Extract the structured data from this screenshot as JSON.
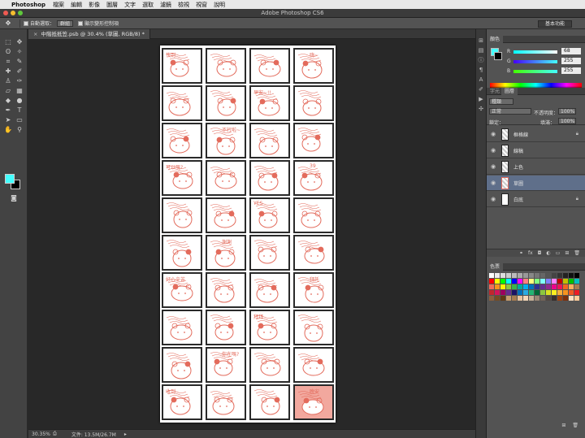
{
  "menubar": {
    "app_name": "Photoshop",
    "items": [
      "檔案",
      "編輯",
      "影像",
      "圖層",
      "文字",
      "選取",
      "濾鏡",
      "檢視",
      "視窗",
      "說明"
    ]
  },
  "window": {
    "title": "Adobe Photoshop CS6"
  },
  "options_bar": {
    "auto_select_label": "自動選取：",
    "auto_select_value": "群組",
    "show_transform_label": "顯示變形控制項",
    "workspace": "基本功能"
  },
  "document_tab": {
    "label": "中階抵抵笠.psb @ 30.4% (草圖, RGB/8) *"
  },
  "status_bar": {
    "zoom": "30.35%",
    "doc_size": "文件: 13.5M/26.7M"
  },
  "color_panel": {
    "tabs": [
      "顏色"
    ],
    "r_label": "R",
    "g_label": "G",
    "b_label": "B",
    "r_value": "68",
    "g_value": "255",
    "b_value": "255",
    "foreground": "#44ffff",
    "background": "#000000"
  },
  "layers_panel": {
    "tabs": [
      "字元",
      "圖層"
    ],
    "filter_kind": "種類",
    "blend_mode": "正常",
    "opacity_label": "不透明度：",
    "opacity_value": "100%",
    "lock_label": "鎖定：",
    "fill_label": "填滿：",
    "fill_value": "100%",
    "layers": [
      {
        "name": "框格線",
        "locked": true,
        "selected": false
      },
      {
        "name": "線稿",
        "locked": false,
        "selected": false
      },
      {
        "name": "上色",
        "locked": false,
        "selected": false
      },
      {
        "name": "草圖",
        "locked": false,
        "selected": true
      },
      {
        "name": "白底",
        "locked": true,
        "selected": false
      }
    ]
  },
  "swatches_panel": {
    "tabs": [
      "色票"
    ]
  },
  "canvas": {
    "stroke_color": "#e36b5c",
    "texts": [
      "快到",
      "嗨~",
      "早安~!!",
      "不行啦~",
      "可以嗎?",
      "39",
      "YES",
      "謝謝",
      "好心辛苦",
      "拜託",
      "拜拜",
      "你在嗎?",
      "收到",
      "晚安",
      "對不起",
      "好棒!!",
      "我來了",
      "加油",
      "吃大餐!!",
      "抱抱",
      "謝謝你",
      "人家",
      "好冷",
      "生氣!"
    ]
  }
}
